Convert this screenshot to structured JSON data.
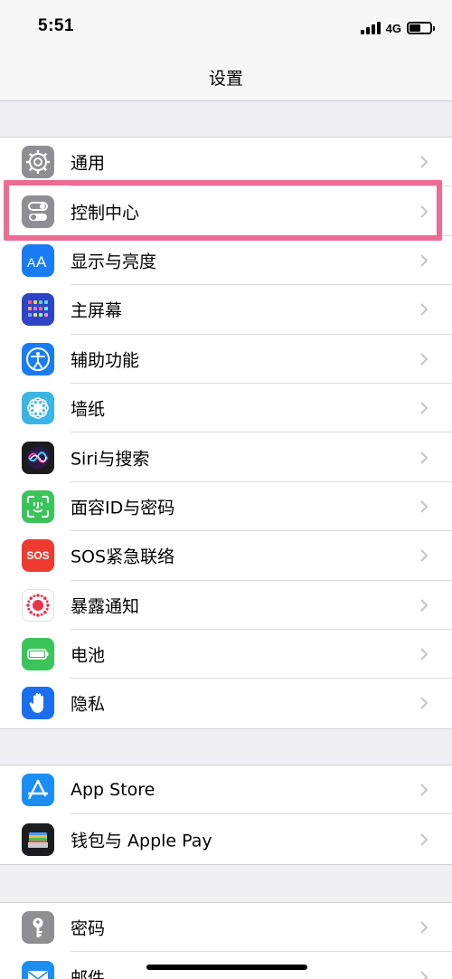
{
  "status_bar": {
    "time": "5:51",
    "network": "4G"
  },
  "nav": {
    "title": "设置"
  },
  "groups": [
    {
      "items": [
        {
          "label": "通用",
          "icon": "gear-icon",
          "color": "#8e8e93"
        },
        {
          "label": "控制中心",
          "icon": "toggles-icon",
          "color": "#8e8e93"
        },
        {
          "label": "显示与亮度",
          "icon": "aa-icon",
          "color": "#1a7cf5"
        },
        {
          "label": "主屏幕",
          "icon": "grid-icon",
          "color": "#2d44c7"
        },
        {
          "label": "辅助功能",
          "icon": "accessibility-icon",
          "color": "#1a7cf5"
        },
        {
          "label": "墙纸",
          "icon": "flower-icon",
          "color": "#3bb5e6"
        },
        {
          "label": "Siri与搜索",
          "icon": "siri-icon",
          "color": "#1c1c1e"
        },
        {
          "label": "面容ID与密码",
          "icon": "faceid-icon",
          "color": "#3ac45a"
        },
        {
          "label": "SOS紧急联络",
          "icon": "sos-icon",
          "color": "#ee3b30"
        },
        {
          "label": "暴露通知",
          "icon": "exposure-icon",
          "color": "#ffffff"
        },
        {
          "label": "电池",
          "icon": "battery-icon",
          "color": "#3ac45a"
        },
        {
          "label": "隐私",
          "icon": "hand-icon",
          "color": "#1a6ef0"
        }
      ]
    },
    {
      "items": [
        {
          "label": "App Store",
          "icon": "app-store-icon",
          "color": "#1a8ef5"
        },
        {
          "label": "钱包与 Apple Pay",
          "icon": "wallet-icon",
          "color": "#1c1c1e"
        }
      ]
    },
    {
      "items": [
        {
          "label": "密码",
          "icon": "key-icon",
          "color": "#8e8e93"
        },
        {
          "label": "邮件",
          "icon": "mail-icon",
          "color": "#1a8ef5"
        }
      ]
    }
  ],
  "icons": {
    "sos_text": "SOS"
  },
  "colors": {
    "highlight": "#ef6b94",
    "background": "#efeff4",
    "chevron": "#c4c4c9"
  }
}
